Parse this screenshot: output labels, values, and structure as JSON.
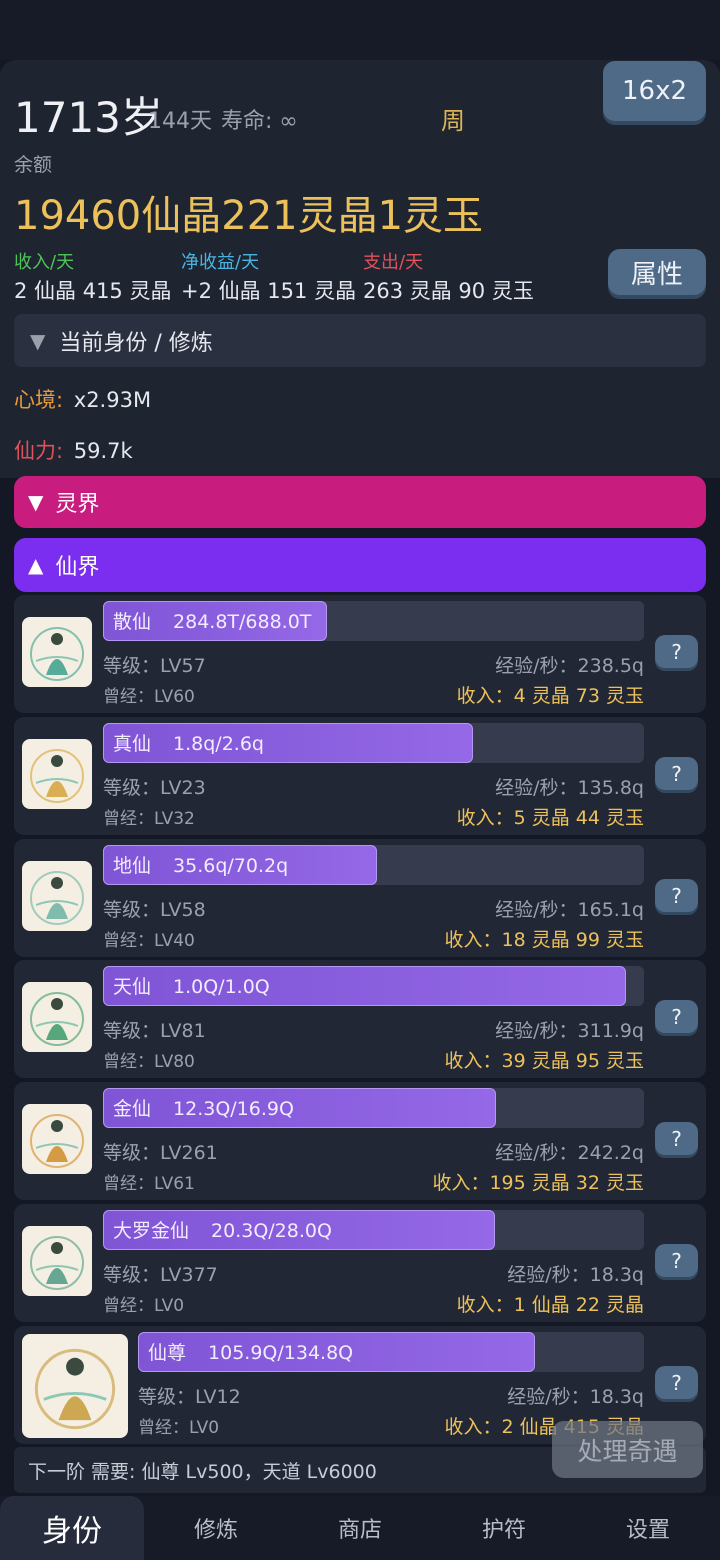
{
  "header": {
    "age": "1713岁",
    "days": "144天",
    "lifespan": "寿命: ∞",
    "week": "周",
    "speed_button": "16x2"
  },
  "balance": {
    "label": "余额",
    "value": "19460仙晶221灵晶1灵玉"
  },
  "stats": {
    "income_label": "收入/天",
    "income_value": "2 仙晶 415 灵晶",
    "net_label": "净收益/天",
    "net_value": "+2 仙晶 151 灵晶",
    "expense_label": "支出/天",
    "expense_value": "263 灵晶 90 灵玉",
    "attr_button": "属性",
    "colors": {
      "income": "#4fc35a",
      "net": "#4ab3e0",
      "expense": "#e0525a"
    }
  },
  "identity_section": {
    "arrow": "▼",
    "title": "当前身份 / 修炼",
    "mood_key": "心境:",
    "mood_value": "x2.93M",
    "power_key": "仙力:",
    "power_value": "59.7k"
  },
  "realms": {
    "spirit": {
      "arrow": "▼",
      "label": "灵界",
      "color": "#c81d7e"
    },
    "immortal": {
      "arrow": "▲",
      "label": "仙界",
      "color": "#7c2ef0"
    }
  },
  "jobs": [
    {
      "name": "散仙",
      "progress_text": "284.8T/688.0T",
      "progress": 0.414,
      "level": "等级：LV57",
      "prev": "曾经：LV60",
      "xp": "经验/秒：238.5q",
      "income": "收入：4 灵晶 73 灵玉",
      "help": "?"
    },
    {
      "name": "真仙",
      "progress_text": "1.8q/2.6q",
      "progress": 0.684,
      "level": "等级：LV23",
      "prev": "曾经：LV32",
      "xp": "经验/秒：135.8q",
      "income": "收入：5 灵晶 44 灵玉",
      "help": "?"
    },
    {
      "name": "地仙",
      "progress_text": "35.6q/70.2q",
      "progress": 0.507,
      "level": "等级：LV58",
      "prev": "曾经：LV40",
      "xp": "经验/秒：165.1q",
      "income": "收入：18 灵晶 99 灵玉",
      "help": "?"
    },
    {
      "name": "天仙",
      "progress_text": "1.0Q/1.0Q",
      "progress": 0.966,
      "level": "等级：LV81",
      "prev": "曾经：LV80",
      "xp": "经验/秒：311.9q",
      "income": "收入：39 灵晶 95 灵玉",
      "help": "?"
    },
    {
      "name": "金仙",
      "progress_text": "12.3Q/16.9Q",
      "progress": 0.727,
      "level": "等级：LV261",
      "prev": "曾经：LV61",
      "xp": "经验/秒：242.2q",
      "income": "收入：195 灵晶 32 灵玉",
      "help": "?"
    },
    {
      "name": "大罗金仙",
      "progress_text": "20.3Q/28.0Q",
      "progress": 0.725,
      "level": "等级：LV377",
      "prev": "曾经：LV0",
      "xp": "经验/秒：18.3q",
      "income": "收入：1 仙晶 22 灵晶",
      "help": "?"
    },
    {
      "name": "仙尊",
      "progress_text": "105.9Q/134.8Q",
      "progress": 0.785,
      "level": "等级：LV12",
      "prev": "曾经：LV0",
      "xp": "经验/秒：18.3q",
      "income": "收入：2 仙晶 415 灵晶",
      "help": "?"
    }
  ],
  "next_tier": "下一阶 需要: 仙尊 Lv500，天道 Lv6000",
  "event_button": "处理奇遇",
  "nav": [
    "身份",
    "修炼",
    "商店",
    "护符",
    "设置"
  ]
}
